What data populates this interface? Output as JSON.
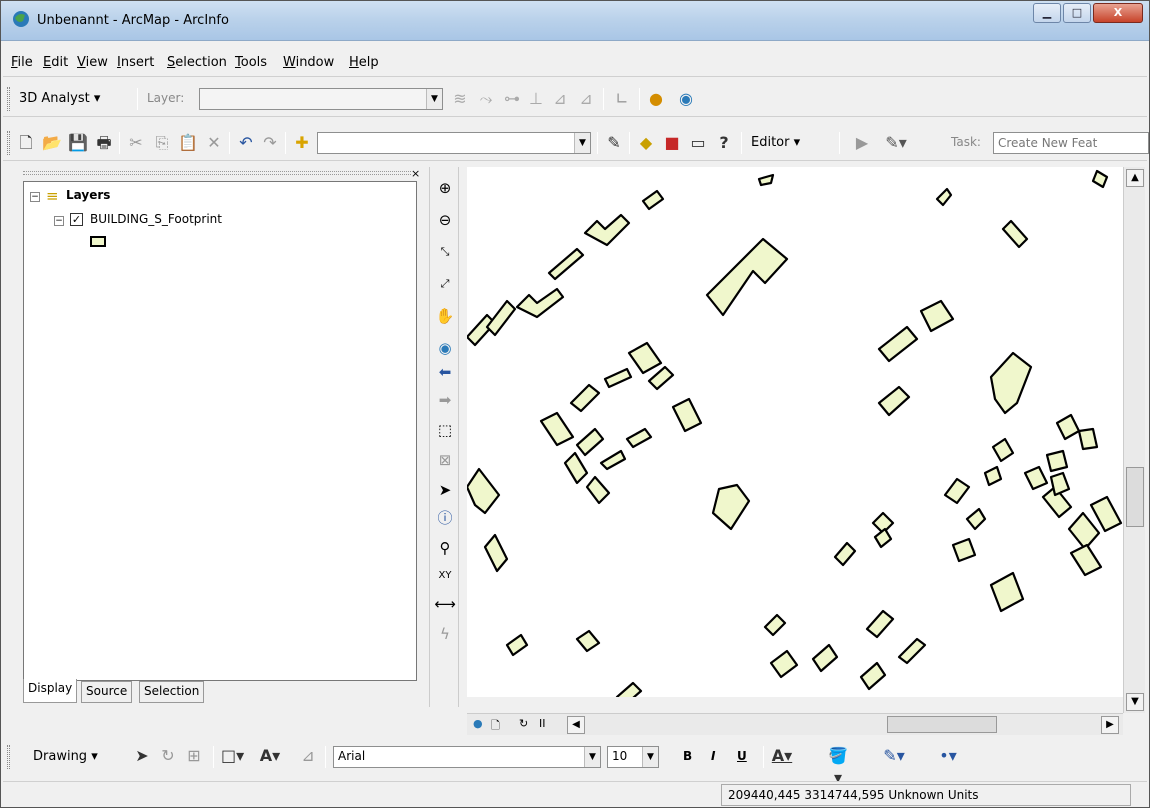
{
  "window": {
    "title": "Unbenannt - ArcMap - ArcInfo"
  },
  "menu": [
    "File",
    "Edit",
    "View",
    "Insert",
    "Selection",
    "Tools",
    "Window",
    "Help"
  ],
  "toolbar3d": {
    "label": "3D Analyst ▾",
    "layer_label": "Layer:",
    "layer_value": ""
  },
  "standard": {
    "scale_value": "",
    "editor_label": "Editor ▾",
    "task_label": "Task:",
    "task_value": "Create New Feat"
  },
  "toc": {
    "root_label": "Layers",
    "layer_label": "BUILDING_S_Footprint",
    "tabs": [
      "Display",
      "Source",
      "Selection"
    ]
  },
  "drawing": {
    "label": "Drawing ▾",
    "font_name": "Arial",
    "font_size": "10",
    "bold": "B",
    "italic": "I",
    "underline": "U"
  },
  "status": {
    "coords": "209440,445 3314744,595 Unknown Units"
  },
  "colors": {
    "feature_fill": "#f0f7cc",
    "feature_stroke": "#000000"
  },
  "icons": [
    "zoom-in-icon",
    "zoom-out-icon",
    "fixed-zoom-in-icon",
    "fixed-zoom-out-icon",
    "pan-icon",
    "full-extent-icon",
    "back-icon",
    "forward-icon",
    "select-features-icon",
    "clear-selection-icon",
    "select-elements-icon",
    "identify-icon",
    "find-icon",
    "go-to-xy-icon",
    "measure-icon",
    "hyperlink-icon"
  ]
}
